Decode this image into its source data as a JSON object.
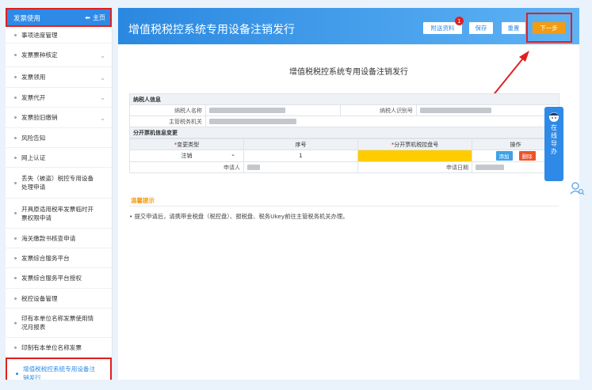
{
  "sidebar": {
    "header_title": "发票使用",
    "home_label": "主页",
    "items": [
      {
        "label": "事项进度管理",
        "chevron": false
      },
      {
        "label": "发票票种核定",
        "chevron": true
      },
      {
        "label": "发票领用",
        "chevron": true
      },
      {
        "label": "发票代开",
        "chevron": true
      },
      {
        "label": "发票验旧缴销",
        "chevron": true
      },
      {
        "label": "风险告知",
        "chevron": false
      },
      {
        "label": "网上认证",
        "chevron": false
      },
      {
        "label": "丢失（被盗）税控专用设备处理申请",
        "chevron": false
      },
      {
        "label": "开具原适用税率发票临时开票权限申请",
        "chevron": false
      },
      {
        "label": "海关缴款书核查申请",
        "chevron": false
      },
      {
        "label": "发票综合服务平台",
        "chevron": false
      },
      {
        "label": "发票综合服务平台授权",
        "chevron": false
      },
      {
        "label": "税控设备管理",
        "chevron": false
      },
      {
        "label": "印有本单位名称发票使用情况月报表",
        "chevron": false
      },
      {
        "label": "印制有本单位名称发票",
        "chevron": false
      },
      {
        "label": "增值税税控系统专用设备注销发行",
        "chevron": false,
        "active": true
      }
    ]
  },
  "main": {
    "title": "增值税税控系统专用设备注销发行",
    "page_title": "增值税税控系统专用设备注销发行",
    "buttons": {
      "attach": "附送资料",
      "attach_badge": "1",
      "save": "保存",
      "reset": "重置",
      "next": "下一步"
    },
    "taxpayer": {
      "section": "纳税人信息",
      "name_label": "纳税人名称",
      "id_label": "纳税人识别号",
      "authority_label": "主管税务机关"
    },
    "change": {
      "section": "分开票机信息变更",
      "col_type": "变更类型",
      "col_seq": "序号",
      "col_device": "分开票机税控盘号",
      "col_ops": "操作",
      "required_mark": "*",
      "row_type": "注销",
      "row_seq": "1",
      "add_label": "添加",
      "delete_label": "删除",
      "applicant_label": "申请人",
      "apply_date_label": "申请日期"
    },
    "tip_label": "温馨提示",
    "tip_text": "• 提交申请后，请携带金税盘（税控盘）、报税盘、税务Ukey前往主管税务机关办理。"
  },
  "help_widget": {
    "chars": [
      "在",
      "线",
      "导",
      "办"
    ]
  },
  "colors": {
    "primary": "#2e8ae6",
    "highlight_border": "#e02020",
    "next_button": "#f39c12",
    "device_field": "#ffcc00"
  }
}
